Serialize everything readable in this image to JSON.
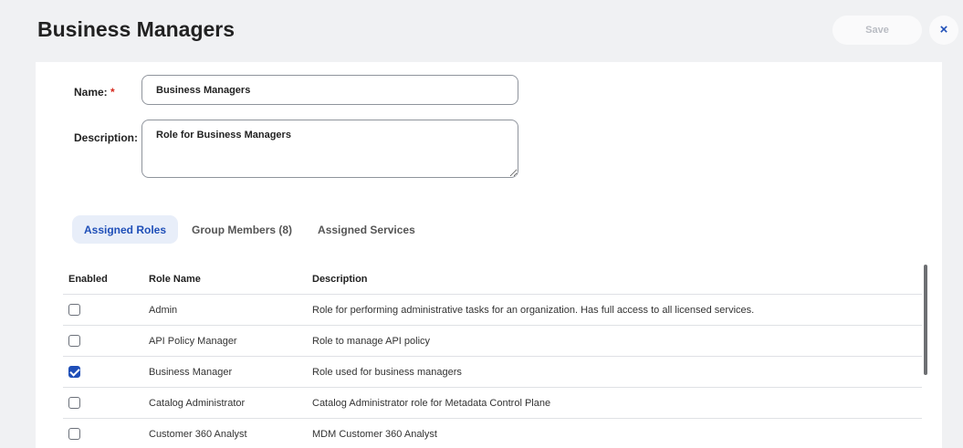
{
  "header": {
    "title": "Business Managers",
    "save_label": "Save",
    "close_glyph": "×"
  },
  "form": {
    "name_label": "Name:",
    "required_mark": "*",
    "name_value": "Business Managers",
    "description_label": "Description:",
    "description_value": "Role for Business Managers"
  },
  "tabs": [
    {
      "label": "Assigned Roles",
      "active": true
    },
    {
      "label": "Group Members (8)",
      "active": false
    },
    {
      "label": "Assigned Services",
      "active": false
    }
  ],
  "table": {
    "columns": [
      "Enabled",
      "Role Name",
      "Description"
    ],
    "rows": [
      {
        "enabled": false,
        "name": "Admin",
        "description": "Role for performing administrative tasks for an organization. Has full access to all licensed services."
      },
      {
        "enabled": false,
        "name": "API Policy Manager",
        "description": "Role to manage API policy"
      },
      {
        "enabled": true,
        "name": "Business Manager",
        "description": "Role used for business managers"
      },
      {
        "enabled": false,
        "name": "Catalog Administrator",
        "description": "Catalog Administrator role for Metadata Control Plane"
      },
      {
        "enabled": false,
        "name": "Customer 360 Analyst",
        "description": "MDM Customer 360 Analyst"
      }
    ]
  },
  "colors": {
    "accent": "#1f4fb8",
    "required": "#d6281d",
    "background": "#f0f1f3"
  }
}
